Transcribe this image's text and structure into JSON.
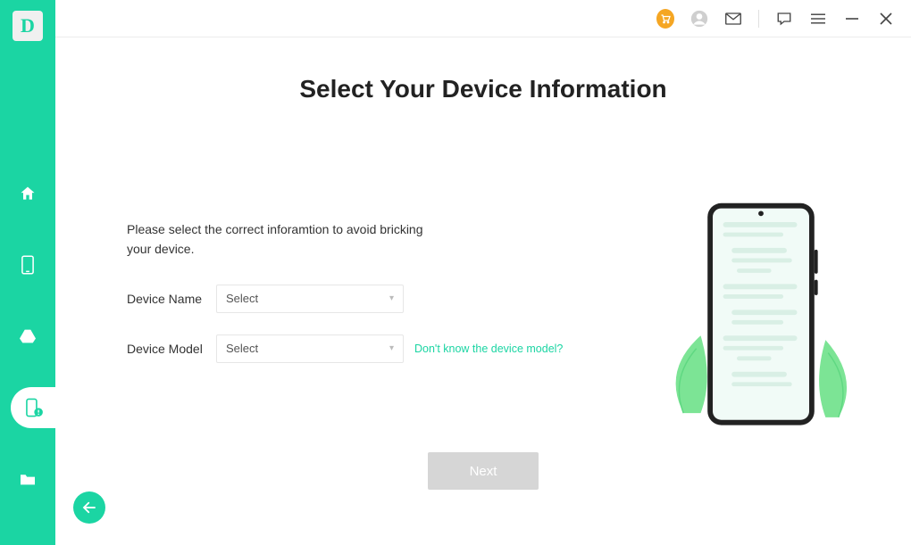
{
  "logo": "D",
  "titlebar": {
    "cart": "cart",
    "profile": "profile",
    "mail": "mail",
    "feedback": "feedback",
    "menu": "menu",
    "minimize": "minimize",
    "close": "close"
  },
  "sidebar": {
    "items": [
      {
        "id": "home"
      },
      {
        "id": "phone"
      },
      {
        "id": "drive"
      },
      {
        "id": "repair"
      },
      {
        "id": "folder"
      }
    ],
    "active_index": 3
  },
  "main": {
    "title": "Select Your Device Information",
    "instruction": "Please select the correct inforamtion to avoid bricking your device.",
    "fields": {
      "device_name": {
        "label": "Device Name",
        "value": "Select"
      },
      "device_model": {
        "label": "Device Model",
        "value": "Select",
        "helper": "Don't know the device model?"
      }
    },
    "next_label": "Next"
  }
}
